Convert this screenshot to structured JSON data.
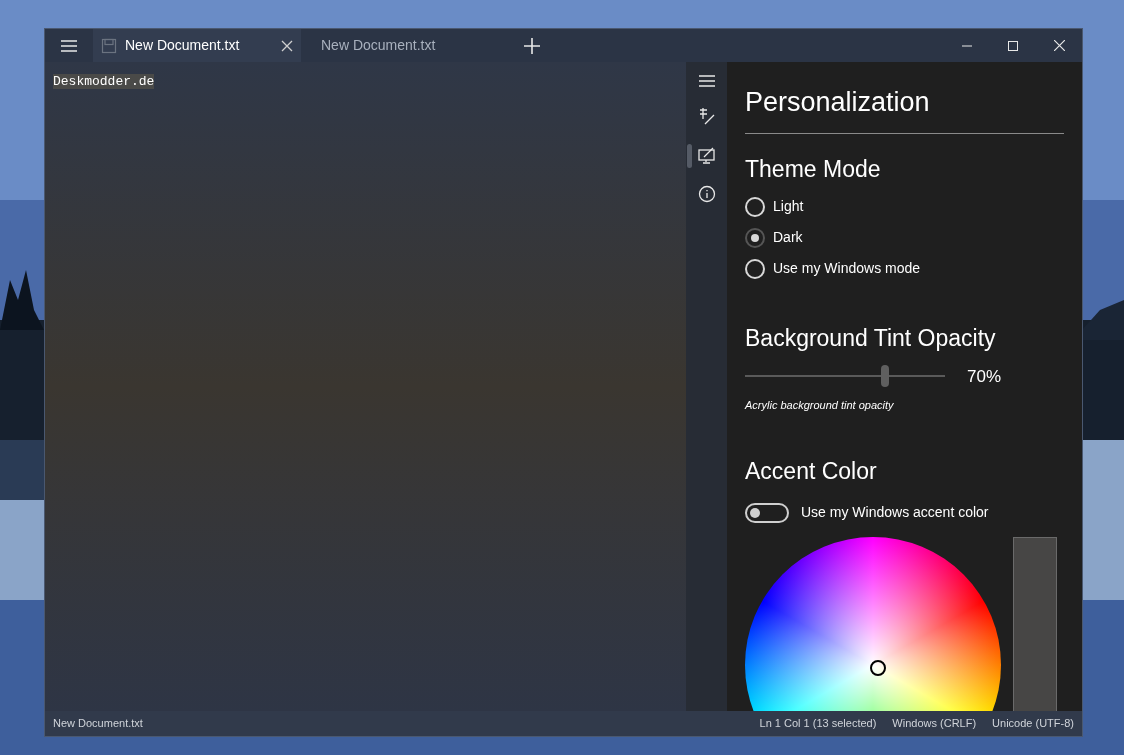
{
  "tabs": [
    {
      "title": "New Document.txt",
      "selected": true
    },
    {
      "title": "New Document.txt",
      "selected": false
    }
  ],
  "editor": {
    "text": "Deskmodder.de",
    "selected": true
  },
  "side_rail": [
    {
      "kind": "font",
      "selected": false
    },
    {
      "kind": "personalization",
      "selected": true
    },
    {
      "kind": "about",
      "selected": false
    }
  ],
  "settings": {
    "title": "Personalization",
    "theme_mode": {
      "heading": "Theme Mode",
      "options": [
        {
          "label": "Light",
          "selected": false
        },
        {
          "label": "Dark",
          "selected": true
        },
        {
          "label": "Use my Windows mode",
          "selected": false
        }
      ]
    },
    "tint": {
      "heading": "Background Tint Opacity",
      "level": 0.7,
      "reading": "70%",
      "caption": "Acrylic background tint opacity"
    },
    "accent": {
      "heading": "Accent Color",
      "toggle": {
        "label": "Use my Windows accent color",
        "on": false
      }
    }
  },
  "status_bar": {
    "file": "New Document.txt",
    "position": "Ln 1 Col 1 (13 selected)",
    "line_ending": "Windows (CRLF)",
    "encoding": "Unicode (UTF-8)"
  }
}
